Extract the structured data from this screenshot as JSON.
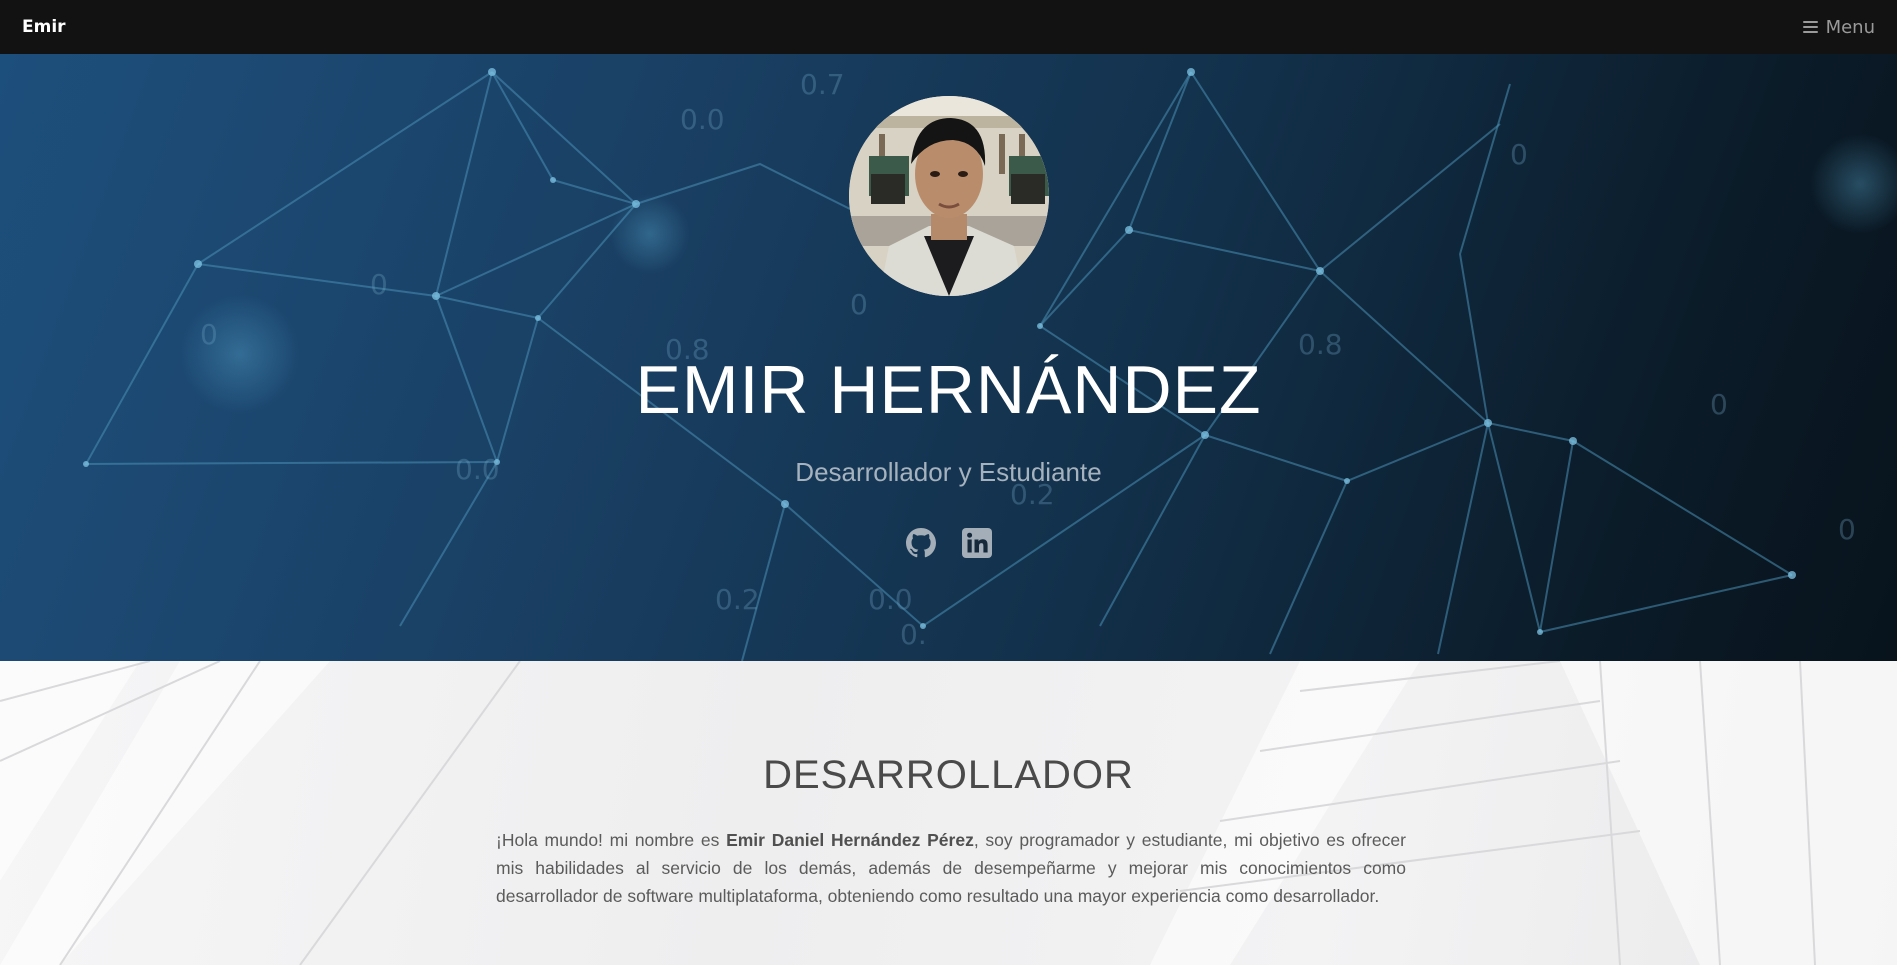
{
  "navbar": {
    "brand": "Emir",
    "menu_label": "Menu",
    "menu_icon": "bars-icon"
  },
  "hero": {
    "name": "EMIR HERNÁNDEZ",
    "subtitle": "Desarrollador y Estudiante",
    "avatar_alt": "avatar",
    "social": [
      {
        "name": "github",
        "icon": "github-icon"
      },
      {
        "name": "linkedin",
        "icon": "linkedin-icon"
      }
    ],
    "bg_numbers": [
      "0.7",
      "0.0",
      "0.0",
      "0.8",
      "0.0",
      "0.2",
      "0.0",
      "0.2",
      "0",
      "0",
      "0",
      "0.0",
      "0.0",
      "0",
      "0"
    ]
  },
  "about": {
    "title": "DESARROLLADOR",
    "text_before": "¡Hola mundo! mi nombre es ",
    "text_bold": "Emir Daniel Hernández Pérez",
    "text_after": ", soy programador y estudiante, mi objetivo es ofrecer mis habilidades al servicio de los demás, además de desempeñarme y mejorar mis conocimientos como desarrollador de software multiplataforma, obteniendo como resultado una mayor experiencia como desarrollador."
  },
  "colors": {
    "navbar_bg": "#121212",
    "hero_bg_start": "#1d4f7c",
    "hero_bg_end": "#08131c",
    "about_bg": "#f2f2f3"
  }
}
